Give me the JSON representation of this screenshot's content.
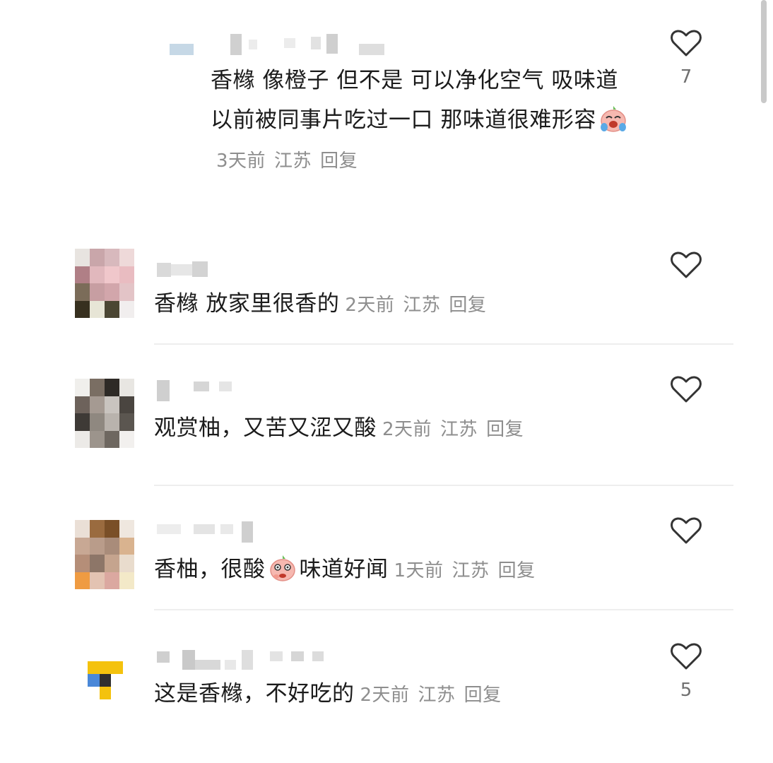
{
  "comments": [
    {
      "text": "香橼 像橙子 但不是 可以净化空气 吸味道 以前被同事片吃过一口 那味道很难形容",
      "emoji": "crying-laugh-peach-emoji",
      "time": "3天前",
      "location": "江苏",
      "reply": "回复",
      "likes": "7"
    },
    {
      "text": "香橼 放家里很香的",
      "time": "2天前",
      "location": "江苏",
      "reply": "回复",
      "likes": ""
    },
    {
      "text": "观赏柚，又苦又涩又酸",
      "time": "2天前",
      "location": "江苏",
      "reply": "回复",
      "likes": ""
    },
    {
      "text_before": "香柚，很酸",
      "emoji": "sour-face-peach-emoji",
      "text_after": "味道好闻",
      "time": "1天前",
      "location": "江苏",
      "reply": "回复",
      "likes": ""
    },
    {
      "text": "这是香橼，不好吃的",
      "time": "2天前",
      "location": "江苏",
      "reply": "回复",
      "likes": "5"
    }
  ],
  "icons": {
    "like": "heart-outline-icon",
    "avatar": "pixelated-avatar",
    "username": "pixelated-username"
  },
  "colors": {
    "text": "#1b1b1b",
    "meta": "#8e8e8e",
    "divider": "#eeeeee",
    "heart": "#333333"
  }
}
